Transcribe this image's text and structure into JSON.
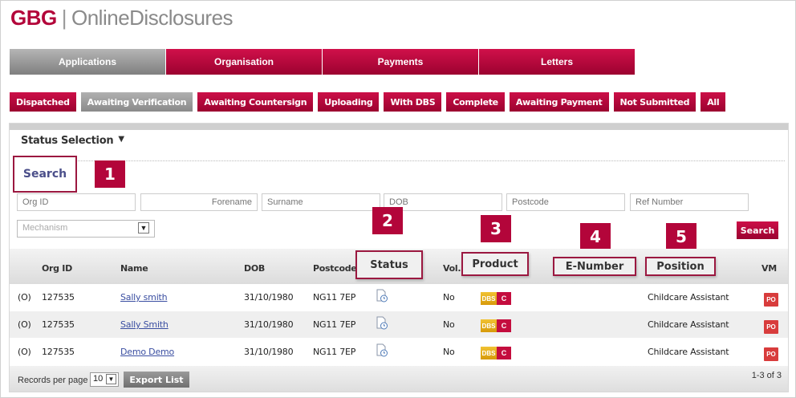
{
  "logo": {
    "brand": "GBG",
    "sep": "|",
    "product": "OnlineDisclosures"
  },
  "main_tabs": [
    {
      "label": "Applications",
      "active": true
    },
    {
      "label": "Organisation"
    },
    {
      "label": "Payments"
    },
    {
      "label": "Letters"
    }
  ],
  "sub_tabs": [
    {
      "label": "Dispatched"
    },
    {
      "label": "Awaiting Verification",
      "active": true
    },
    {
      "label": "Awaiting Countersign"
    },
    {
      "label": "Uploading"
    },
    {
      "label": "With DBS"
    },
    {
      "label": "Complete"
    },
    {
      "label": "Awaiting Payment"
    },
    {
      "label": "Not Submitted"
    },
    {
      "label": "All"
    }
  ],
  "status_selection": {
    "label": "Status Selection",
    "arrow": "▼"
  },
  "search": {
    "heading": "Search",
    "placeholders": {
      "org_id": "Org ID",
      "forename": "Forename",
      "surname": "Surname",
      "dob": "DOB",
      "postcode": "Postcode",
      "ref_number": "Ref Number"
    },
    "mechanism": "Mechanism",
    "button": "Search"
  },
  "callouts": [
    "1",
    "2",
    "3",
    "4",
    "5"
  ],
  "table": {
    "headers": {
      "org_id": "Org ID",
      "name": "Name",
      "dob": "DOB",
      "postcode": "Postcode",
      "status": "Status",
      "vol": "Vol.",
      "product": "Product",
      "e_number": "E-Number",
      "position": "Position",
      "vm": "VM"
    },
    "rows": [
      {
        "flag": "(O)",
        "org_id": "127535",
        "name": "Sally smith",
        "dob": "31/10/1980",
        "postcode": "NG11 7EP",
        "vol": "No",
        "product_a": "DBS",
        "product_b": "C",
        "position": "Childcare Assistant",
        "vm": "PO"
      },
      {
        "flag": "(O)",
        "org_id": "127535",
        "name": "Sally Smith",
        "dob": "31/10/1980",
        "postcode": "NG11 7EP",
        "vol": "No",
        "product_a": "DBS",
        "product_b": "C",
        "position": "Childcare Assistant",
        "vm": "PO"
      },
      {
        "flag": "(O)",
        "org_id": "127535",
        "name": "Demo Demo",
        "dob": "31/10/1980",
        "postcode": "NG11 7EP",
        "vol": "No",
        "product_a": "DBS",
        "product_b": "C",
        "position": "Childcare Assistant",
        "vm": "PO"
      }
    ]
  },
  "footer": {
    "records_label": "Records per page",
    "records_value": "10",
    "export_button": "Export List",
    "pager": "1-3 of 3"
  },
  "colors": {
    "brand": "#b3053a",
    "link": "#3a4ea1"
  }
}
